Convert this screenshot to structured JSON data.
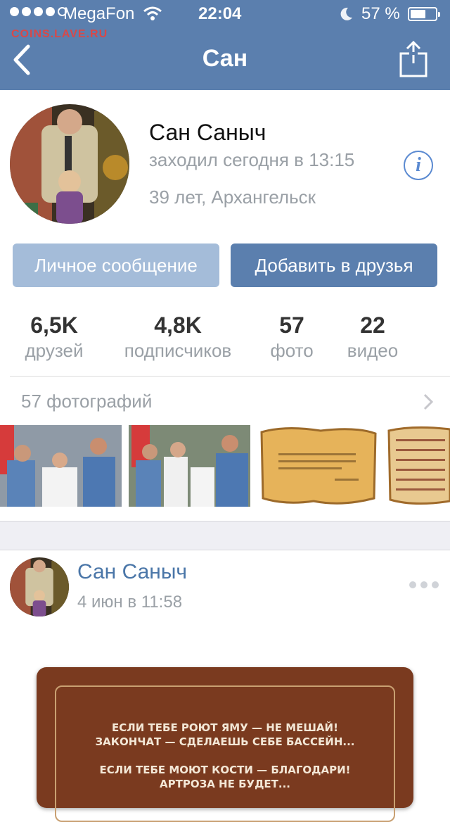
{
  "status_bar": {
    "carrier": "MegaFon",
    "time": "22:04",
    "battery_percent": "57 %",
    "signal_bars_filled": 4,
    "signal_bars_total": 5
  },
  "watermark": "COINS.LAVE.RU",
  "nav": {
    "title": "Сан",
    "back_icon": "chevron-left-icon",
    "share_icon": "share-icon"
  },
  "profile": {
    "name": "Сан Саныч",
    "last_seen": "заходил сегодня в 13:15",
    "age_city": "39 лет, Архангельск",
    "info_label": "i"
  },
  "actions": {
    "message_label": "Личное сообщение",
    "add_friend_label": "Добавить в друзья"
  },
  "counters": [
    {
      "value": "6,5K",
      "label": "друзей"
    },
    {
      "value": "4,8K",
      "label": "подписчиков"
    },
    {
      "value": "57",
      "label": "фото"
    },
    {
      "value": "22",
      "label": "видео"
    }
  ],
  "photos": {
    "title": "57 фотографий"
  },
  "post": {
    "author": "Сан Саныч",
    "date": "4 июн в 11:58",
    "text": "ЕСЛИ ТЕБЕ РОЮТ ЯМУ — НЕ МЕШАЙ!\nЗАКОНЧАТ — СДЕЛАЕШЬ СЕБЕ БАССЕЙН...\n\nЕСЛИ ТЕБЕ МОЮТ КОСТИ — БЛАГОДАРИ!\nАРТРОЗА НЕ БУДЕТ..."
  },
  "colors": {
    "header": "#5b7fae",
    "link": "#4a76a8",
    "muted": "#9aa0a6",
    "button_primary": "#5b7fae",
    "button_secondary": "#a4bcd9"
  }
}
